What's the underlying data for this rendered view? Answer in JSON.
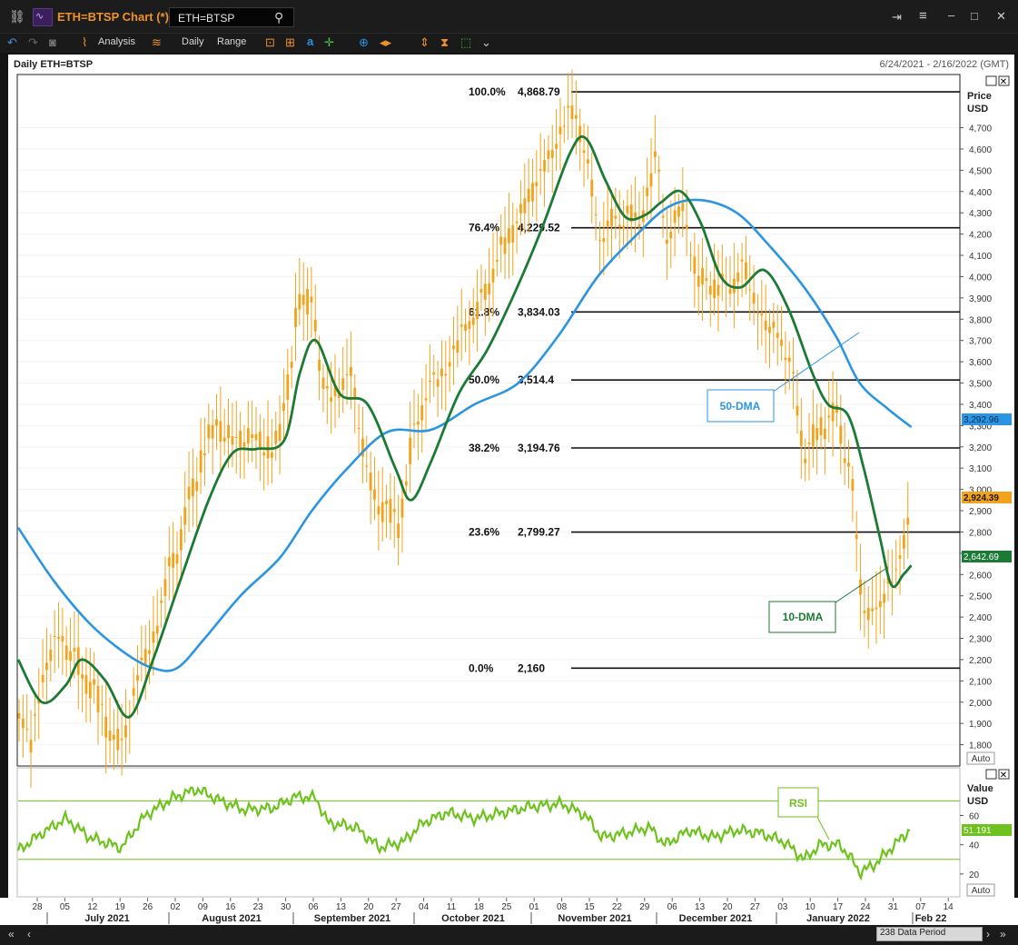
{
  "window": {
    "title": "ETH=BTSP Chart (*)",
    "search_value": "ETH=BTSP"
  },
  "toolbar": {
    "analysis": "Analysis",
    "interval": "Daily",
    "range": "Range"
  },
  "chart_header": {
    "instrument": "Daily ETH=BTSP",
    "date_range": "6/24/2021 - 2/16/2022 (GMT)"
  },
  "price_axis": {
    "title": "Price",
    "unit": "USD",
    "auto_label": "Auto"
  },
  "rsi_axis": {
    "title": "Value",
    "unit": "USD",
    "auto_label": "Auto"
  },
  "time_axis": {
    "day_ticks": [
      "28",
      "05",
      "12",
      "19",
      "26",
      "02",
      "09",
      "16",
      "23",
      "30",
      "06",
      "13",
      "20",
      "27",
      "04",
      "11",
      "18",
      "25",
      "01",
      "08",
      "15",
      "22",
      "29",
      "06",
      "13",
      "20",
      "27",
      "03",
      "10",
      "17",
      "24",
      "31",
      "07",
      "14"
    ],
    "months": [
      "July 2021",
      "August 2021",
      "September 2021",
      "October 2021",
      "November 2021",
      "December 2021",
      "January 2022",
      "Feb 22"
    ]
  },
  "status": {
    "data_period": "238 Data Period"
  },
  "annotations": {
    "dma50": "50-DMA",
    "dma10": "10-DMA",
    "rsi": "RSI"
  },
  "colors": {
    "candle": "#f3a21b",
    "dma10": "#1b7a33",
    "dma50": "#2a95e3",
    "rsi": "#6ec21d",
    "accent": "#f0922a"
  },
  "chart_data": {
    "type": "line",
    "title": "Daily ETH=BTSP",
    "ylabel": "Price USD",
    "ylim": [
      1700,
      4950
    ],
    "y_ticks": [
      1800,
      1900,
      2000,
      2100,
      2200,
      2300,
      2400,
      2500,
      2600,
      2700,
      2800,
      2900,
      3000,
      3100,
      3200,
      3300,
      3400,
      3500,
      3600,
      3700,
      3800,
      3900,
      4000,
      4100,
      4200,
      4300,
      4400,
      4500,
      4600,
      4700
    ],
    "y_tick_labels": [
      "1,800",
      "1,900",
      "2,000",
      "2,100",
      "2,200",
      "2,300",
      "2,400",
      "2,500",
      "2,600",
      "2,700",
      "2,800",
      "2,900",
      "3,000",
      "3,100",
      "3,200",
      "3,300",
      "3,400",
      "3,500",
      "3,600",
      "3,700",
      "3,800",
      "3,900",
      "4,000",
      "4,100",
      "4,200",
      "4,300",
      "4,400",
      "4,500",
      "4,600",
      "4,700"
    ],
    "fib_levels": [
      {
        "pct": "100.0%",
        "value": 4868.79,
        "label": "4,868.79"
      },
      {
        "pct": "76.4%",
        "value": 4229.52,
        "label": "4,229.52"
      },
      {
        "pct": "61.8%",
        "value": 3834.03,
        "label": "3,834.03"
      },
      {
        "pct": "50.0%",
        "value": 3514.4,
        "label": "3,514.4"
      },
      {
        "pct": "38.2%",
        "value": 3194.76,
        "label": "3,194.76"
      },
      {
        "pct": "23.6%",
        "value": 2799.27,
        "label": "2,799.27"
      },
      {
        "pct": "0.0%",
        "value": 2160,
        "label": "2,160"
      }
    ],
    "last_values": {
      "price": "2,924.39",
      "dma50": "3,292.96",
      "dma10": "2,642.69",
      "rsi": "51.191"
    },
    "price_path": [
      [
        "2021-06-24",
        1980
      ],
      [
        "2021-06-27",
        1780
      ],
      [
        "2021-07-01",
        2200
      ],
      [
        "2021-07-05",
        2320
      ],
      [
        "2021-07-08",
        2200
      ],
      [
        "2021-07-12",
        2100
      ],
      [
        "2021-07-15",
        1950
      ],
      [
        "2021-07-20",
        1780
      ],
      [
        "2021-07-24",
        2130
      ],
      [
        "2021-07-28",
        2300
      ],
      [
        "2021-08-01",
        2600
      ],
      [
        "2021-08-05",
        2850
      ],
      [
        "2021-08-09",
        3150
      ],
      [
        "2021-08-13",
        3300
      ],
      [
        "2021-08-17",
        3220
      ],
      [
        "2021-08-21",
        3250
      ],
      [
        "2021-08-25",
        3200
      ],
      [
        "2021-08-29",
        3230
      ],
      [
        "2021-09-02",
        3800
      ],
      [
        "2021-09-06",
        3950
      ],
      [
        "2021-09-08",
        3500
      ],
      [
        "2021-09-12",
        3450
      ],
      [
        "2021-09-16",
        3550
      ],
      [
        "2021-09-20",
        3050
      ],
      [
        "2021-09-24",
        2900
      ],
      [
        "2021-09-28",
        2850
      ],
      [
        "2021-10-02",
        3300
      ],
      [
        "2021-10-06",
        3500
      ],
      [
        "2021-10-10",
        3550
      ],
      [
        "2021-10-14",
        3750
      ],
      [
        "2021-10-18",
        3850
      ],
      [
        "2021-10-22",
        4050
      ],
      [
        "2021-10-26",
        4200
      ],
      [
        "2021-10-30",
        4350
      ],
      [
        "2021-11-03",
        4500
      ],
      [
        "2021-11-07",
        4650
      ],
      [
        "2021-11-10",
        4800
      ],
      [
        "2021-11-14",
        4600
      ],
      [
        "2021-11-17",
        4200
      ],
      [
        "2021-11-21",
        4250
      ],
      [
        "2021-11-25",
        4300
      ],
      [
        "2021-11-28",
        4250
      ],
      [
        "2021-12-02",
        4600
      ],
      [
        "2021-12-04",
        4150
      ],
      [
        "2021-12-08",
        4350
      ],
      [
        "2021-12-12",
        4000
      ],
      [
        "2021-12-16",
        3950
      ],
      [
        "2021-12-20",
        3950
      ],
      [
        "2021-12-24",
        4050
      ],
      [
        "2021-12-28",
        3800
      ],
      [
        "2022-01-01",
        3750
      ],
      [
        "2022-01-05",
        3550
      ],
      [
        "2022-01-08",
        3150
      ],
      [
        "2022-01-12",
        3300
      ],
      [
        "2022-01-16",
        3350
      ],
      [
        "2022-01-20",
        3050
      ],
      [
        "2022-01-22",
        2550
      ],
      [
        "2022-01-24",
        2400
      ],
      [
        "2022-01-27",
        2450
      ],
      [
        "2022-01-30",
        2600
      ],
      [
        "2022-02-02",
        2700
      ],
      [
        "2022-02-04",
        2924
      ]
    ],
    "series": [
      {
        "name": "50-DMA",
        "points": [
          [
            "2021-06-24",
            2820
          ],
          [
            "2021-07-03",
            2570
          ],
          [
            "2021-07-12",
            2370
          ],
          [
            "2021-07-21",
            2230
          ],
          [
            "2021-07-28",
            2160
          ],
          [
            "2021-08-03",
            2160
          ],
          [
            "2021-08-10",
            2300
          ],
          [
            "2021-08-19",
            2500
          ],
          [
            "2021-08-29",
            2680
          ],
          [
            "2021-09-06",
            2900
          ],
          [
            "2021-09-15",
            3100
          ],
          [
            "2021-09-25",
            3270
          ],
          [
            "2021-10-06",
            3280
          ],
          [
            "2021-10-17",
            3400
          ],
          [
            "2021-10-28",
            3500
          ],
          [
            "2021-11-07",
            3720
          ],
          [
            "2021-11-17",
            4000
          ],
          [
            "2021-11-27",
            4200
          ],
          [
            "2021-12-05",
            4330
          ],
          [
            "2021-12-13",
            4360
          ],
          [
            "2021-12-22",
            4300
          ],
          [
            "2021-12-30",
            4150
          ],
          [
            "2022-01-08",
            3950
          ],
          [
            "2022-01-16",
            3720
          ],
          [
            "2022-01-22",
            3500
          ],
          [
            "2022-01-29",
            3380
          ],
          [
            "2022-02-04",
            3293
          ]
        ]
      },
      {
        "name": "10-DMA",
        "points": [
          [
            "2021-06-24",
            2200
          ],
          [
            "2021-06-30",
            2000
          ],
          [
            "2021-07-06",
            2080
          ],
          [
            "2021-07-10",
            2200
          ],
          [
            "2021-07-16",
            2100
          ],
          [
            "2021-07-22",
            1930
          ],
          [
            "2021-07-28",
            2200
          ],
          [
            "2021-08-04",
            2580
          ],
          [
            "2021-08-11",
            2950
          ],
          [
            "2021-08-17",
            3170
          ],
          [
            "2021-08-23",
            3190
          ],
          [
            "2021-08-30",
            3230
          ],
          [
            "2021-09-03",
            3550
          ],
          [
            "2021-09-07",
            3700
          ],
          [
            "2021-09-13",
            3450
          ],
          [
            "2021-09-20",
            3400
          ],
          [
            "2021-09-27",
            3100
          ],
          [
            "2021-10-01",
            2950
          ],
          [
            "2021-10-06",
            3130
          ],
          [
            "2021-10-13",
            3450
          ],
          [
            "2021-10-20",
            3650
          ],
          [
            "2021-10-27",
            3920
          ],
          [
            "2021-11-03",
            4230
          ],
          [
            "2021-11-10",
            4580
          ],
          [
            "2021-11-14",
            4650
          ],
          [
            "2021-11-19",
            4450
          ],
          [
            "2021-11-24",
            4280
          ],
          [
            "2021-11-29",
            4290
          ],
          [
            "2021-12-03",
            4350
          ],
          [
            "2021-12-08",
            4400
          ],
          [
            "2021-12-13",
            4250
          ],
          [
            "2021-12-18",
            4000
          ],
          [
            "2021-12-23",
            3950
          ],
          [
            "2021-12-29",
            4030
          ],
          [
            "2022-01-04",
            3850
          ],
          [
            "2022-01-10",
            3550
          ],
          [
            "2022-01-14",
            3400
          ],
          [
            "2022-01-19",
            3350
          ],
          [
            "2022-01-23",
            3100
          ],
          [
            "2022-01-27",
            2780
          ],
          [
            "2022-01-30",
            2550
          ],
          [
            "2022-02-02",
            2600
          ],
          [
            "2022-02-04",
            2643
          ]
        ]
      }
    ],
    "rsi": {
      "ylim": [
        5,
        92
      ],
      "y_ticks": [
        20,
        40,
        60
      ],
      "bands": [
        70,
        30
      ],
      "points": [
        [
          "2021-06-24",
          36
        ],
        [
          "2021-06-30",
          48
        ],
        [
          "2021-07-06",
          58
        ],
        [
          "2021-07-12",
          45
        ],
        [
          "2021-07-20",
          38
        ],
        [
          "2021-07-26",
          60
        ],
        [
          "2021-08-02",
          72
        ],
        [
          "2021-08-08",
          78
        ],
        [
          "2021-08-14",
          70
        ],
        [
          "2021-08-20",
          64
        ],
        [
          "2021-08-27",
          65
        ],
        [
          "2021-09-02",
          73
        ],
        [
          "2021-09-07",
          72
        ],
        [
          "2021-09-10",
          55
        ],
        [
          "2021-09-17",
          52
        ],
        [
          "2021-09-23",
          38
        ],
        [
          "2021-09-29",
          42
        ],
        [
          "2021-10-04",
          55
        ],
        [
          "2021-10-10",
          62
        ],
        [
          "2021-10-17",
          58
        ],
        [
          "2021-10-24",
          62
        ],
        [
          "2021-10-31",
          66
        ],
        [
          "2021-11-08",
          68
        ],
        [
          "2021-11-14",
          60
        ],
        [
          "2021-11-18",
          45
        ],
        [
          "2021-11-24",
          48
        ],
        [
          "2021-11-30",
          52
        ],
        [
          "2021-12-04",
          40
        ],
        [
          "2021-12-10",
          50
        ],
        [
          "2021-12-16",
          45
        ],
        [
          "2021-12-22",
          50
        ],
        [
          "2021-12-28",
          48
        ],
        [
          "2022-01-03",
          42
        ],
        [
          "2022-01-08",
          30
        ],
        [
          "2022-01-12",
          40
        ],
        [
          "2022-01-17",
          40
        ],
        [
          "2022-01-20",
          30
        ],
        [
          "2022-01-22",
          21
        ],
        [
          "2022-01-26",
          27
        ],
        [
          "2022-01-30",
          38
        ],
        [
          "2022-02-04",
          51
        ]
      ]
    }
  }
}
